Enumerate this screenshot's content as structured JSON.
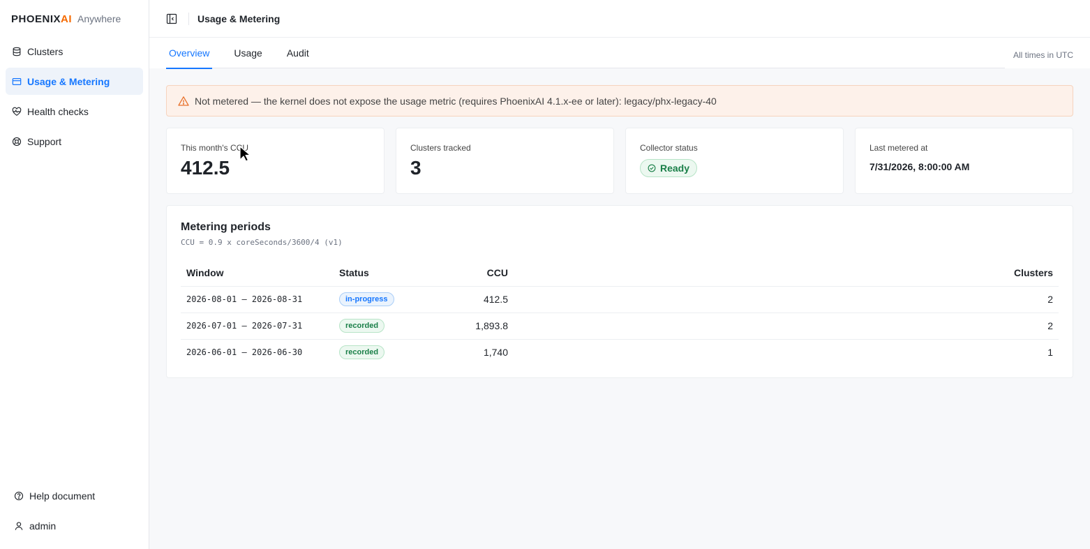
{
  "brand": {
    "name_prefix": "PHOENIX",
    "name_suffix": "AI",
    "product": "Anywhere"
  },
  "sidebar": {
    "items": [
      {
        "label": "Clusters",
        "icon": "database-icon",
        "active": false
      },
      {
        "label": "Usage & Metering",
        "icon": "credit-card-icon",
        "active": true
      },
      {
        "label": "Health checks",
        "icon": "heart-pulse-icon",
        "active": false
      },
      {
        "label": "Support",
        "icon": "lifebuoy-icon",
        "active": false
      }
    ],
    "bottom": [
      {
        "label": "Help document",
        "icon": "help-circle-icon"
      },
      {
        "label": "admin",
        "icon": "user-icon"
      }
    ]
  },
  "header": {
    "title": "Usage & Metering"
  },
  "tabs": [
    {
      "label": "Overview",
      "active": true
    },
    {
      "label": "Usage",
      "active": false
    },
    {
      "label": "Audit",
      "active": false
    }
  ],
  "timezone_note": "All times in UTC",
  "alert": {
    "text": "Not metered — the kernel does not expose the usage metric (requires PhoenixAI 4.1.x-ee or later): legacy/phx-legacy-40",
    "icon": "warning-triangle-icon"
  },
  "cards": {
    "ccu": {
      "label": "This month's CCU",
      "value": "412.5"
    },
    "clusters": {
      "label": "Clusters tracked",
      "value": "3"
    },
    "collector": {
      "label": "Collector status",
      "value": "Ready"
    },
    "last_metered": {
      "label": "Last metered at",
      "value": "7/31/2026, 8:00:00 AM"
    }
  },
  "periods": {
    "title": "Metering periods",
    "formula": "CCU = 0.9 x coreSeconds/3600/4 (v1)",
    "columns": {
      "window": "Window",
      "status": "Status",
      "ccu": "CCU",
      "clusters": "Clusters"
    },
    "rows": [
      {
        "window": "2026-08-01 – 2026-08-31",
        "status": "in-progress",
        "ccu": "412.5",
        "clusters": "2"
      },
      {
        "window": "2026-07-01 – 2026-07-31",
        "status": "recorded",
        "ccu": "1,893.8",
        "clusters": "2"
      },
      {
        "window": "2026-06-01 – 2026-06-30",
        "status": "recorded",
        "ccu": "1,740",
        "clusters": "1"
      }
    ]
  },
  "colors": {
    "accent": "#1677ff",
    "brand_orange": "#f56a00",
    "success": "#1a7f48",
    "warning_bg": "#fdf1ea"
  }
}
